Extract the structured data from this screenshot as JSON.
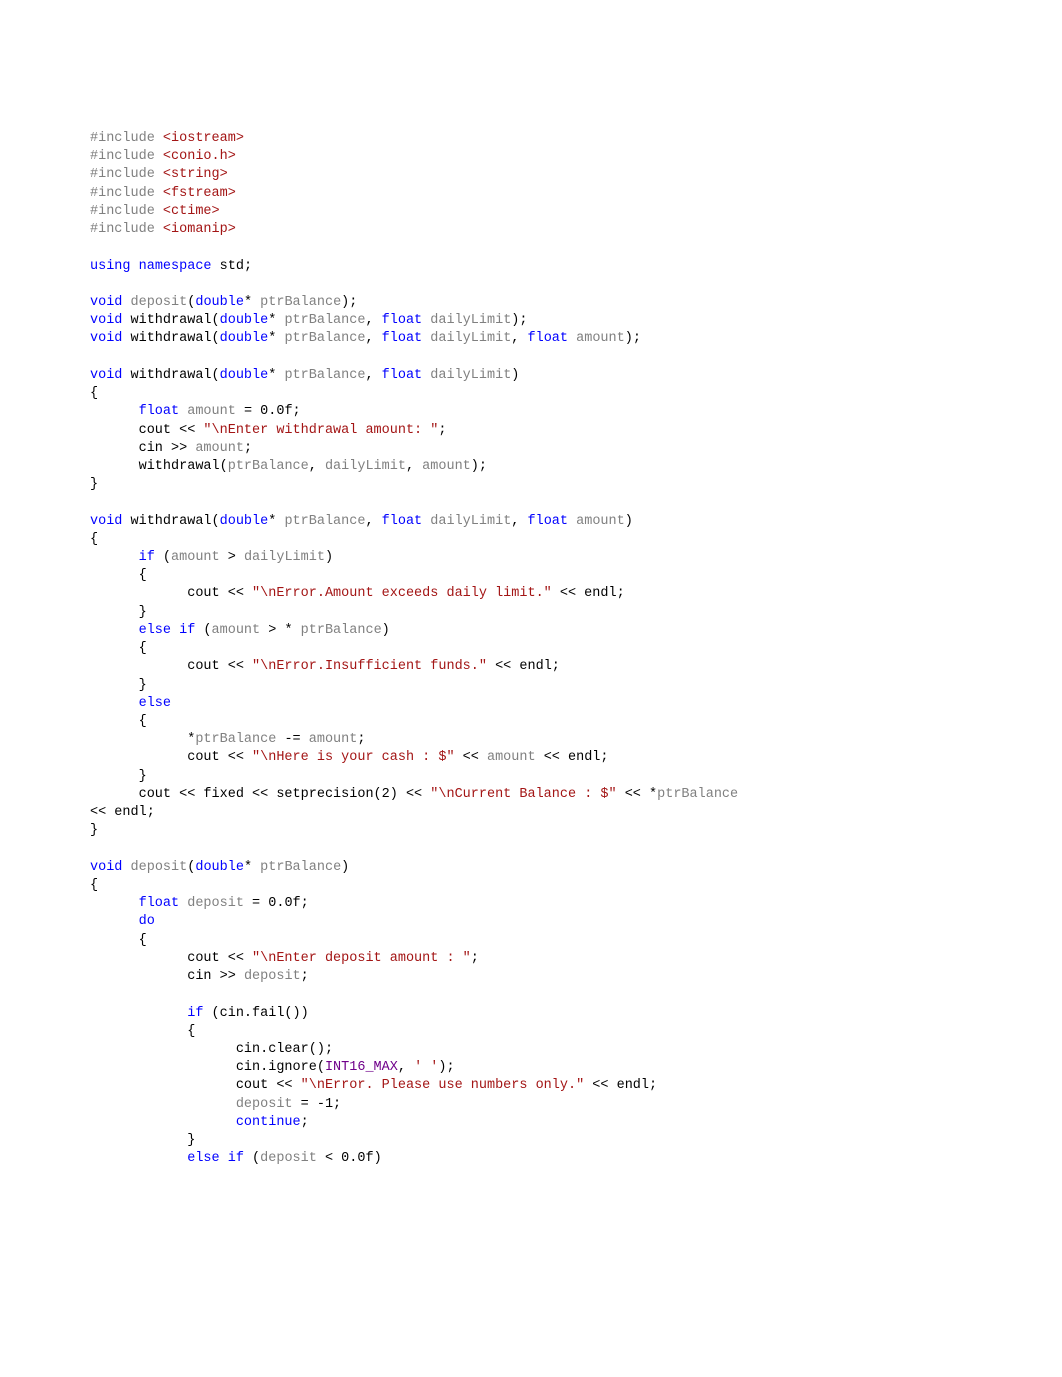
{
  "code": {
    "lines": [
      {
        "t": "preproc",
        "content": "#include <iostream>"
      },
      {
        "t": "preproc",
        "content": "#include <conio.h>"
      },
      {
        "t": "preproc",
        "content": "#include <string>"
      },
      {
        "t": "preproc",
        "content": "#include <fstream>"
      },
      {
        "t": "preproc",
        "content": "#include <ctime>"
      },
      {
        "t": "preproc",
        "content": "#include <iomanip>"
      },
      {
        "t": "blank",
        "content": ""
      },
      {
        "t": "using",
        "content": "using namespace std;"
      },
      {
        "t": "blank",
        "content": ""
      },
      {
        "t": "decl",
        "content": "void deposit(double* ptrBalance);"
      },
      {
        "t": "decl",
        "content": "void withdrawal(double* ptrBalance, float dailyLimit);"
      },
      {
        "t": "decl",
        "content": "void withdrawal(double* ptrBalance, float dailyLimit, float amount);"
      },
      {
        "t": "blank",
        "content": ""
      },
      {
        "t": "decl",
        "content": "void withdrawal(double* ptrBalance, float dailyLimit)"
      },
      {
        "t": "plain",
        "content": "{"
      },
      {
        "t": "body",
        "content": "      float amount = 0.0f;"
      },
      {
        "t": "body",
        "content": "      cout << \"\\nEnter withdrawal amount: \";"
      },
      {
        "t": "body",
        "content": "      cin >> amount;"
      },
      {
        "t": "body",
        "content": "      withdrawal(ptrBalance, dailyLimit, amount);"
      },
      {
        "t": "plain",
        "content": "}"
      },
      {
        "t": "blank",
        "content": ""
      },
      {
        "t": "decl",
        "content": "void withdrawal(double* ptrBalance, float dailyLimit, float amount)"
      },
      {
        "t": "plain",
        "content": "{"
      },
      {
        "t": "body",
        "content": "      if (amount > dailyLimit)"
      },
      {
        "t": "plain",
        "content": "      {"
      },
      {
        "t": "body",
        "content": "            cout << \"\\nError.Amount exceeds daily limit.\" << endl;"
      },
      {
        "t": "plain",
        "content": "      }"
      },
      {
        "t": "body",
        "content": "      else if (amount > * ptrBalance)"
      },
      {
        "t": "plain",
        "content": "      {"
      },
      {
        "t": "body",
        "content": "            cout << \"\\nError.Insufficient funds.\" << endl;"
      },
      {
        "t": "plain",
        "content": "      }"
      },
      {
        "t": "body",
        "content": "      else"
      },
      {
        "t": "plain",
        "content": "      {"
      },
      {
        "t": "body",
        "content": "            *ptrBalance -= amount;"
      },
      {
        "t": "body",
        "content": "            cout << \"\\nHere is your cash : $\" << amount << endl;"
      },
      {
        "t": "plain",
        "content": "      }"
      },
      {
        "t": "body",
        "content": "      cout << fixed << setprecision(2) << \"\\nCurrent Balance : $\" << *ptrBalance"
      },
      {
        "t": "body",
        "content": "<< endl;"
      },
      {
        "t": "plain",
        "content": "}"
      },
      {
        "t": "blank",
        "content": ""
      },
      {
        "t": "decl",
        "content": "void deposit(double* ptrBalance)"
      },
      {
        "t": "plain",
        "content": "{"
      },
      {
        "t": "body",
        "content": "      float deposit = 0.0f;"
      },
      {
        "t": "body",
        "content": "      do"
      },
      {
        "t": "plain",
        "content": "      {"
      },
      {
        "t": "body",
        "content": "            cout << \"\\nEnter deposit amount : \";"
      },
      {
        "t": "body",
        "content": "            cin >> deposit;"
      },
      {
        "t": "blank",
        "content": ""
      },
      {
        "t": "body",
        "content": "            if (cin.fail())"
      },
      {
        "t": "plain",
        "content": "            {"
      },
      {
        "t": "body",
        "content": "                  cin.clear();"
      },
      {
        "t": "body",
        "content": "                  cin.ignore(INT16_MAX, ' ');"
      },
      {
        "t": "body",
        "content": "                  cout << \"\\nError. Please use numbers only.\" << endl;"
      },
      {
        "t": "body",
        "content": "                  deposit = -1;"
      },
      {
        "t": "body",
        "content": "                  continue;"
      },
      {
        "t": "plain",
        "content": "            }"
      },
      {
        "t": "body",
        "content": "            else if (deposit < 0.0f)"
      }
    ]
  }
}
